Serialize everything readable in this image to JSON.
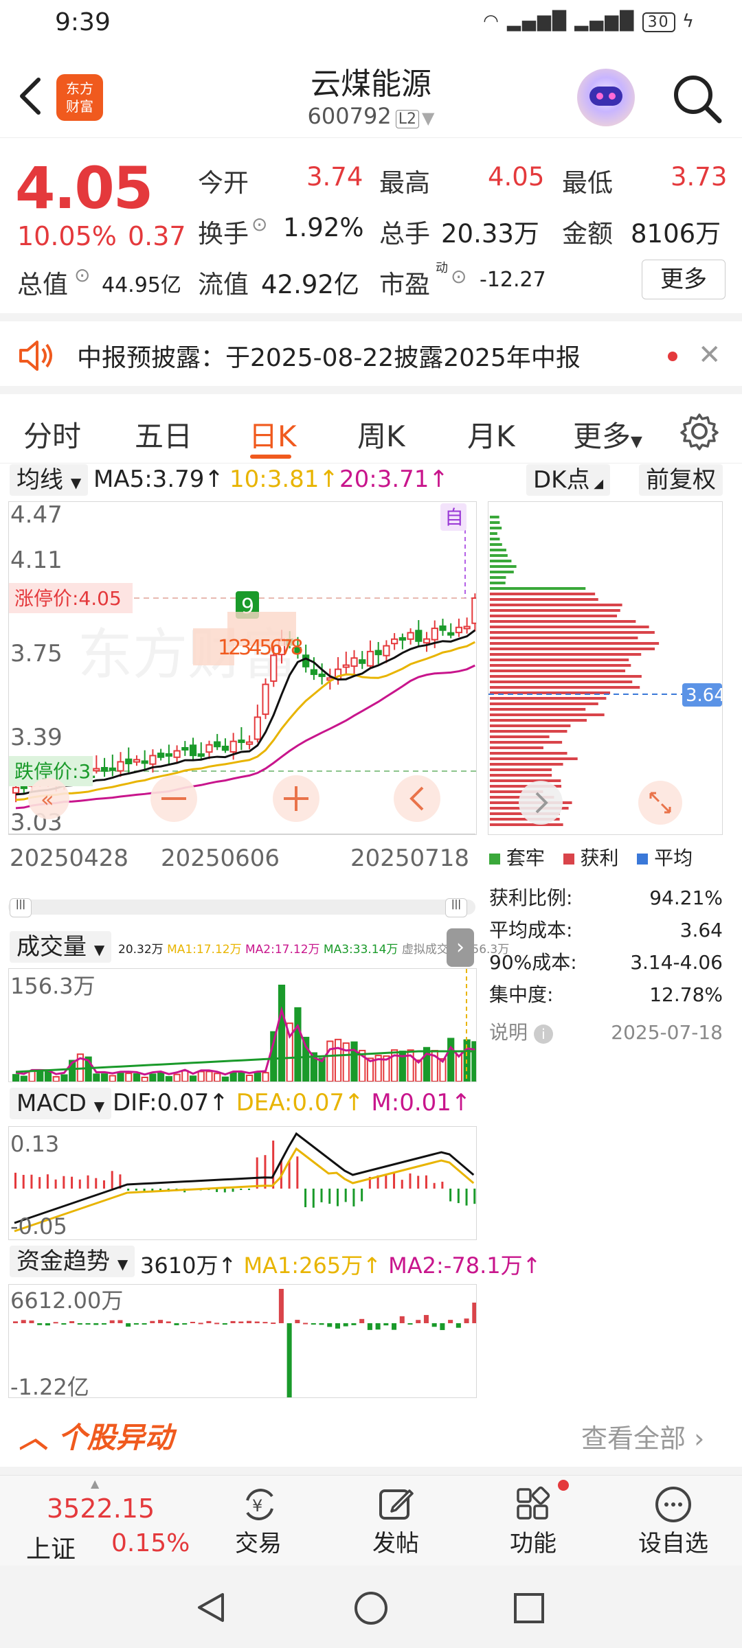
{
  "status_bar": {
    "time": "9:39",
    "battery": "30",
    "signal_icons": "wifi 4G 4G"
  },
  "header": {
    "title": "云煤能源",
    "code": "600792",
    "level": "L2",
    "logo_text_line1": "东方",
    "logo_text_line2": "财富"
  },
  "quote": {
    "price": "4.05",
    "change_pct": "10.05%",
    "change_amt": "0.37",
    "open_label": "今开",
    "open": "3.74",
    "high_label": "最高",
    "high": "4.05",
    "low_label": "最低",
    "low": "3.73",
    "turnover_label": "换手",
    "turnover": "1.92%",
    "volume_label": "总手",
    "volume": "20.33万",
    "amount_label": "金额",
    "amount": "8106万",
    "mktcap_label": "总值",
    "mktcap": "44.95亿",
    "float_label": "流值",
    "float_cap": "42.92亿",
    "pe_label": "市盈",
    "pe_sup": "动",
    "pe": "-12.27",
    "more_label": "更多"
  },
  "notice": {
    "text": "中报预披露：于2025-08-22披露2025年中报"
  },
  "tabs": [
    "分时",
    "五日",
    "日K",
    "周K",
    "月K",
    "更多"
  ],
  "active_tab": "日K",
  "kline": {
    "indicator": "均线",
    "ma5": "MA5:3.79",
    "ma10": "10:3.81",
    "ma20": "20:3.71",
    "dk_label": "DK点",
    "fq_label": "前复权",
    "zi_label": "自",
    "y_ticks": [
      "4.47",
      "4.11",
      "3.75",
      "3.39",
      "3.03"
    ],
    "limit_up": "涨停价:4.05",
    "limit_down": "跌停价:3.",
    "dates": [
      "20250428",
      "20250606",
      "20250718"
    ],
    "marker_9": "9",
    "marker_nums": "12345678"
  },
  "chip": {
    "avg_label": "3.64",
    "legend": [
      "套牢",
      "获利",
      "平均"
    ],
    "rows": [
      {
        "label": "获利比例:",
        "value": "94.21%"
      },
      {
        "label": "平均成本:",
        "value": "3.64"
      },
      {
        "label": "90%成本:",
        "value": "3.14-4.06"
      },
      {
        "label": "集中度:",
        "value": "12.78%"
      }
    ],
    "note_label": "说明",
    "date": "2025-07-18"
  },
  "volume_panel": {
    "label": "成交量",
    "summary": "20.32万",
    "ma1": "MA1:17.12万",
    "ma2": "MA2:17.12万",
    "ma3": "MA3:33.14万",
    "virtual": "虚拟成交量:156.3万",
    "y_top": "156.3万"
  },
  "macd_panel": {
    "label": "MACD",
    "dif": "DIF:0.07",
    "dea": "DEA:0.07",
    "m": "M:0.01",
    "y_top": "0.13",
    "y_bottom": "-0.05"
  },
  "fund_panel": {
    "label": "资金趋势",
    "value": "3610万",
    "ma1": "MA1:265万",
    "ma2": "MA2:-78.1万",
    "y_top": "6612.00万",
    "y_bottom": "-1.22亿"
  },
  "section": {
    "title": "个股异动",
    "view_all": "查看全部"
  },
  "bottom_nav": {
    "index_value": "3522.15",
    "index_name": "上证",
    "index_pct": "0.15%",
    "items": [
      "交易",
      "发帖",
      "功能",
      "设自选"
    ]
  }
}
